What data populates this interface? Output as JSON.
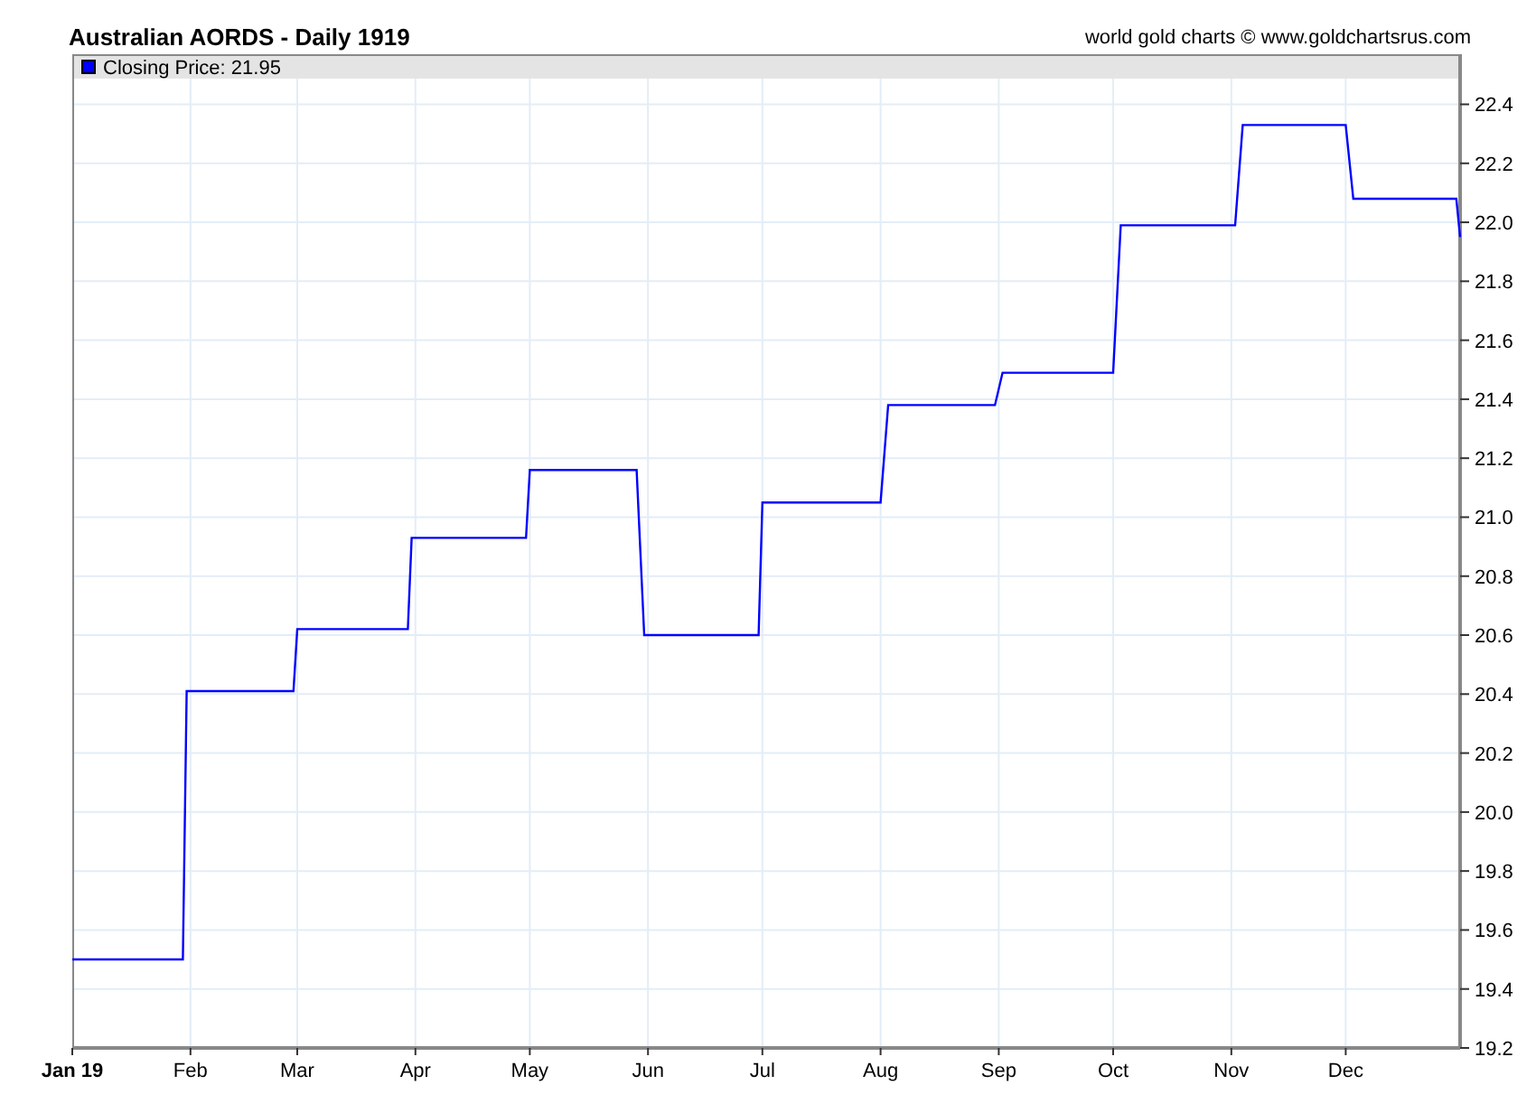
{
  "header": {
    "credit": "world gold charts © www.goldchartsrus.com"
  },
  "chart": {
    "first_tick_bold": true,
    "chart_data": {
      "type": "line",
      "title": "Australian AORDS - Daily 1919",
      "grid": true,
      "x": [
        "1919-01-01",
        "1919-01-30",
        "1919-01-31",
        "1919-02-28",
        "1919-03-01",
        "1919-03-30",
        "1919-03-31",
        "1919-04-30",
        "1919-05-01",
        "1919-05-29",
        "1919-05-31",
        "1919-06-30",
        "1919-07-01",
        "1919-08-01",
        "1919-08-03",
        "1919-08-31",
        "1919-09-02",
        "1919-10-01",
        "1919-10-03",
        "1919-11-02",
        "1919-11-04",
        "1919-12-01",
        "1919-12-03",
        "1919-12-30",
        "1919-12-31"
      ],
      "series": [
        {
          "name": "Closing Price: 21.95",
          "color": "#0000ff",
          "values": [
            19.5,
            19.5,
            20.41,
            20.41,
            20.62,
            20.62,
            20.93,
            20.93,
            21.16,
            21.16,
            20.6,
            20.6,
            21.05,
            21.05,
            21.38,
            21.38,
            21.49,
            21.49,
            21.99,
            21.99,
            22.33,
            22.33,
            22.08,
            22.08,
            21.95
          ]
        }
      ],
      "xlim": [
        "1919-01-01",
        "1919-12-31"
      ],
      "ylim": [
        19.2,
        22.57
      ],
      "xticks": [
        {
          "value": "1919-01-01",
          "label": "Jan 19"
        },
        {
          "value": "1919-02-01",
          "label": "Feb"
        },
        {
          "value": "1919-03-01",
          "label": "Mar"
        },
        {
          "value": "1919-04-01",
          "label": "Apr"
        },
        {
          "value": "1919-05-01",
          "label": "May"
        },
        {
          "value": "1919-06-01",
          "label": "Jun"
        },
        {
          "value": "1919-07-01",
          "label": "Jul"
        },
        {
          "value": "1919-08-01",
          "label": "Aug"
        },
        {
          "value": "1919-09-01",
          "label": "Sep"
        },
        {
          "value": "1919-10-01",
          "label": "Oct"
        },
        {
          "value": "1919-11-01",
          "label": "Nov"
        },
        {
          "value": "1919-12-01",
          "label": "Dec"
        }
      ],
      "yticks": [
        {
          "value": 22.4,
          "label": "22.4"
        },
        {
          "value": 22.2,
          "label": "22.2"
        },
        {
          "value": 22.0,
          "label": "22.0"
        },
        {
          "value": 21.8,
          "label": "21.8"
        },
        {
          "value": 21.6,
          "label": "21.6"
        },
        {
          "value": 21.4,
          "label": "21.4"
        },
        {
          "value": 21.2,
          "label": "21.2"
        },
        {
          "value": 21.0,
          "label": "21.0"
        },
        {
          "value": 20.8,
          "label": "20.8"
        },
        {
          "value": 20.6,
          "label": "20.6"
        },
        {
          "value": 20.4,
          "label": "20.4"
        },
        {
          "value": 20.2,
          "label": "20.2"
        },
        {
          "value": 20.0,
          "label": "20.0"
        },
        {
          "value": 19.8,
          "label": "19.8"
        },
        {
          "value": 19.6,
          "label": "19.6"
        },
        {
          "value": 19.4,
          "label": "19.4"
        },
        {
          "value": 19.2,
          "label": "19.2"
        }
      ]
    }
  }
}
